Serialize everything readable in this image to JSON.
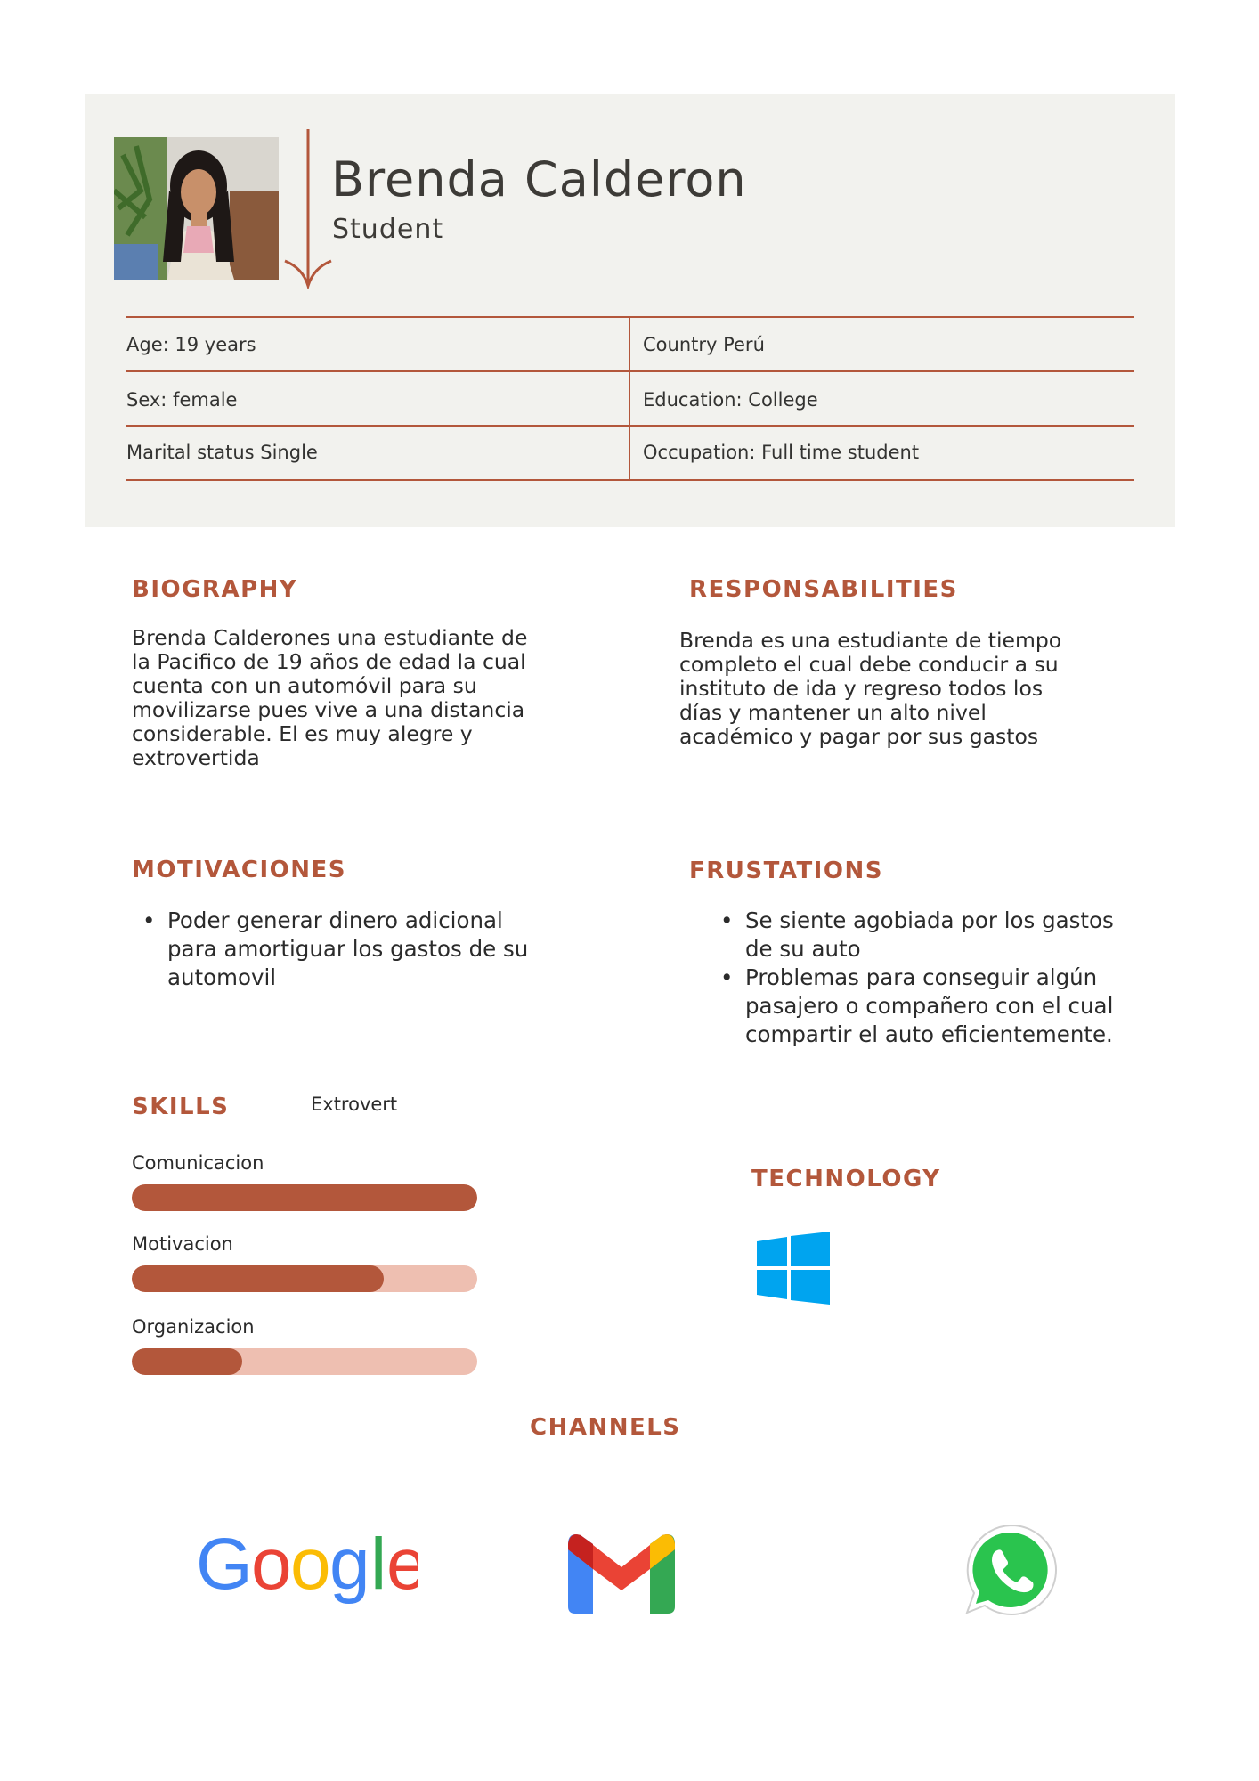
{
  "header": {
    "name": "Brenda Calderon",
    "role": "Student"
  },
  "demographics": {
    "age": "Age: 19 years",
    "country": "Country Perú",
    "sex": "Sex: female",
    "education": "Education: College",
    "marital": "Marital status Single",
    "occupation": "Occupation: Full time student"
  },
  "biography": {
    "title": "BIOGRAPHY",
    "lines": [
      "Brenda Calderones una estudiante de",
      "la Pacifico de 19 años de edad la cual",
      "cuenta con un automóvil para su",
      "movilizarse pues vive a una distancia",
      "considerable. El es muy alegre y",
      "extrovertida"
    ]
  },
  "responsabilities": {
    "title": "RESPONSABILITIES",
    "lines": [
      "Brenda es una estudiante de tiempo",
      "completo el cual debe conducir a su",
      "instituto de ida y regreso todos los",
      "días y mantener un alto nivel",
      "académico y pagar por sus gastos"
    ]
  },
  "motivaciones": {
    "title": "MOTIVACIONES",
    "items": [
      [
        "Poder generar dinero adicional",
        "para amortiguar los gastos de su",
        "automovil"
      ]
    ]
  },
  "frustrations": {
    "title": "FRUSTATIONS",
    "items": [
      [
        "Se siente agobiada por los gastos",
        "de su auto"
      ],
      [
        "Problemas para conseguir algún",
        "pasajero o compañero con el cual",
        "compartir el auto eficientemente."
      ]
    ]
  },
  "skills": {
    "title": "SKILLS",
    "trait": "Extrovert",
    "items": [
      {
        "label": "Comunicacion",
        "level": 1.0
      },
      {
        "label": "Motivacion",
        "level": 0.73
      },
      {
        "label": "Organizacion",
        "level": 0.32
      }
    ]
  },
  "technology": {
    "title": "TECHNOLOGY",
    "icon": "windows-icon"
  },
  "channels": {
    "title": "CHANNELS",
    "google_text": "Google",
    "icons": [
      "google-logo",
      "gmail-icon",
      "whatsapp-icon"
    ]
  },
  "colors": {
    "accent": "#b3573b",
    "bar_track": "#eebfb1",
    "panel": "#f2f2ee",
    "windows_blue": "#00a4ef"
  }
}
